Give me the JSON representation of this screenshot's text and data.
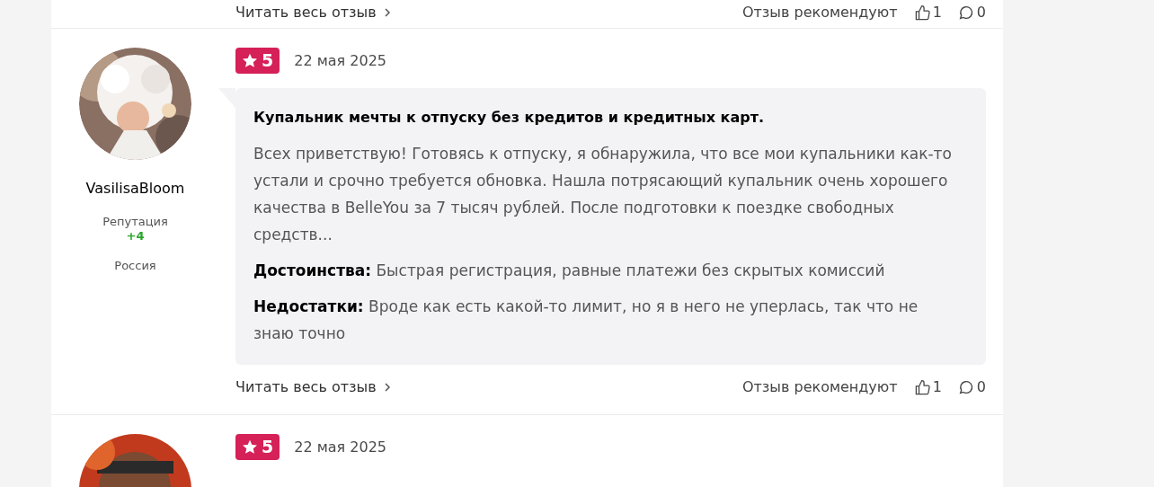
{
  "previous_review_footer": {
    "read_more": "Читать весь отзыв",
    "recommend_label": "Отзыв рекомендуют",
    "likes": "1",
    "comments": "0"
  },
  "review": {
    "author": "VasilisaBloom",
    "reputation_label": "Репутация",
    "reputation": "+4",
    "country": "Россия",
    "rating": "5",
    "date": "22 мая 2025",
    "title": "Купальник мечты к отпуску без кредитов и кредитных карт.",
    "text": "Всех приветствую! Готовясь к отпуску, я обнаружила, что все мои купальники как-то устали и срочно требуется обновка. Нашла потрясающий купальник очень хорошего качества в BelleYou за 7 тысяч рублей. После подготовки к поездке свободных средств...",
    "pros_label": "Достоинства:",
    "pros": "Быстрая регистрация, равные платежи без скрытых комиссий",
    "cons_label": "Недостатки:",
    "cons": "Вроде как есть какой-то лимит, но я в него не уперлась, так что не знаю точно",
    "read_more": "Читать весь отзыв",
    "recommend_label": "Отзыв рекомендуют",
    "likes": "1",
    "comments": "0"
  },
  "next_review": {
    "rating": "5",
    "date": "22 мая 2025"
  }
}
